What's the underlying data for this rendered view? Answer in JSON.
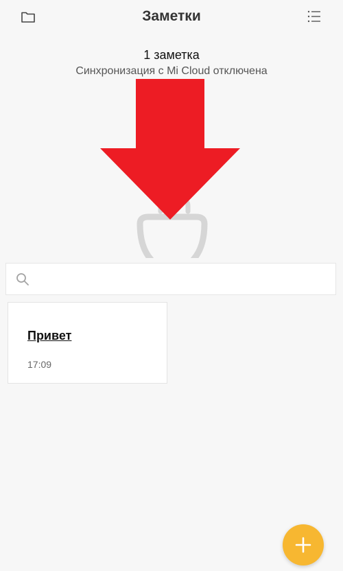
{
  "header": {
    "title": "Заметки",
    "left_icon": "folder-icon",
    "right_icon": "list-menu-icon"
  },
  "status": {
    "notes_count": "1 заметка",
    "sync_text": "Синхронизация с Mi Cloud отключена"
  },
  "search": {
    "placeholder": "",
    "value": "",
    "icon": "search-icon"
  },
  "notes": [
    {
      "title": "Привет",
      "time": "17:09"
    }
  ],
  "fab": {
    "icon": "plus-icon",
    "color": "#f7b731"
  },
  "colors": {
    "background": "#f7f7f7",
    "arrow": "#ed1c24",
    "accent": "#f7b731"
  }
}
